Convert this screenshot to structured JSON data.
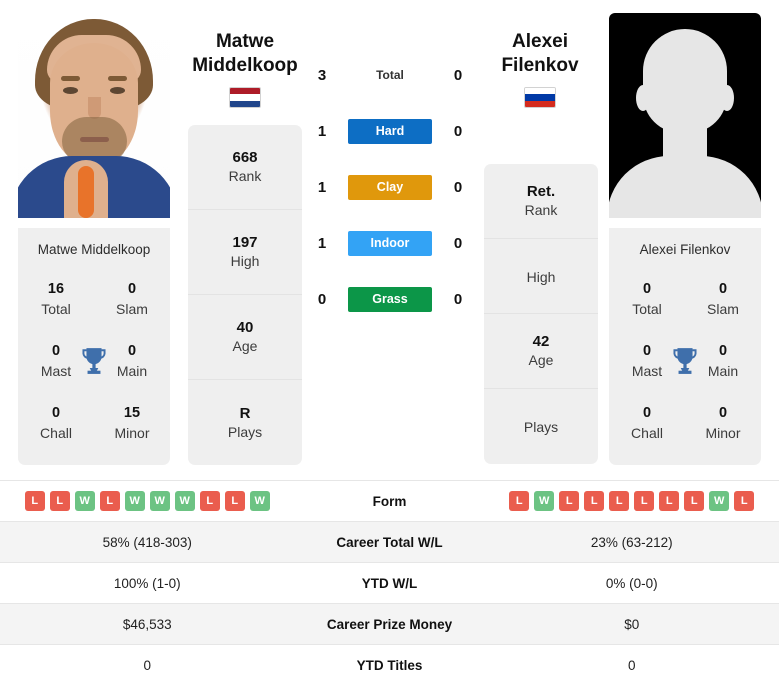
{
  "left_player": {
    "name_line1": "Matwe",
    "name_line2": "Middelkoop",
    "full_name": "Matwe Middelkoop",
    "flag": "netherlands-flag",
    "flag_colors": [
      "#ae1c28",
      "#ffffff",
      "#21468b"
    ],
    "info": [
      {
        "value": "668",
        "label": "Rank"
      },
      {
        "value": "197",
        "label": "High"
      },
      {
        "value": "40",
        "label": "Age"
      },
      {
        "value": "R",
        "label": "Plays"
      }
    ],
    "titles": [
      {
        "value": "16",
        "label": "Total"
      },
      {
        "value": "0",
        "label": "Slam"
      },
      {
        "value": "0",
        "label": "Mast"
      },
      {
        "value": "0",
        "label": "Main"
      },
      {
        "value": "0",
        "label": "Chall"
      },
      {
        "value": "15",
        "label": "Minor"
      }
    ],
    "form": [
      "L",
      "L",
      "W",
      "L",
      "W",
      "W",
      "W",
      "L",
      "L",
      "W"
    ],
    "career_total_wl": "58% (418-303)",
    "ytd_wl": "100% (1-0)",
    "career_prize_money": "$46,533",
    "ytd_titles": "0"
  },
  "right_player": {
    "name_line1": "Alexei",
    "name_line2": "Filenkov",
    "full_name": "Alexei Filenkov",
    "flag": "russia-flag",
    "flag_colors": [
      "#ffffff",
      "#0039a6",
      "#d52b1e"
    ],
    "info": [
      {
        "value": "Ret.",
        "label": "Rank"
      },
      {
        "value": "",
        "label": "High"
      },
      {
        "value": "42",
        "label": "Age"
      },
      {
        "value": "",
        "label": "Plays"
      }
    ],
    "titles": [
      {
        "value": "0",
        "label": "Total"
      },
      {
        "value": "0",
        "label": "Slam"
      },
      {
        "value": "0",
        "label": "Mast"
      },
      {
        "value": "0",
        "label": "Main"
      },
      {
        "value": "0",
        "label": "Chall"
      },
      {
        "value": "0",
        "label": "Minor"
      }
    ],
    "form": [
      "L",
      "W",
      "L",
      "L",
      "L",
      "L",
      "L",
      "L",
      "W",
      "L"
    ],
    "career_total_wl": "23% (63-212)",
    "ytd_wl": "0% (0-0)",
    "career_prize_money": "$0",
    "ytd_titles": "0"
  },
  "h2h": {
    "total": {
      "label": "Total",
      "left": "3",
      "right": "0"
    },
    "surfaces": [
      {
        "label": "Hard",
        "left": "1",
        "right": "0",
        "color": "#0d6ec4"
      },
      {
        "label": "Clay",
        "left": "1",
        "right": "0",
        "color": "#e0980c"
      },
      {
        "label": "Indoor",
        "left": "1",
        "right": "0",
        "color": "#33a3f5"
      },
      {
        "label": "Grass",
        "left": "0",
        "right": "0",
        "color": "#0c9648"
      }
    ]
  },
  "comparison_rows": [
    {
      "label": "Form",
      "type": "form"
    },
    {
      "label": "Career Total W/L",
      "left": "58% (418-303)",
      "right": "23% (63-212)"
    },
    {
      "label": "YTD W/L",
      "left": "100% (1-0)",
      "right": "0% (0-0)"
    },
    {
      "label": "Career Prize Money",
      "left": "$46,533",
      "right": "$0"
    },
    {
      "label": "YTD Titles",
      "left": "0",
      "right": "0"
    }
  ],
  "colors": {
    "win_badge": "#6cc383",
    "loss_badge": "#ea5d4e",
    "card_bg": "#efefef",
    "trophy": "#3f6fab"
  }
}
